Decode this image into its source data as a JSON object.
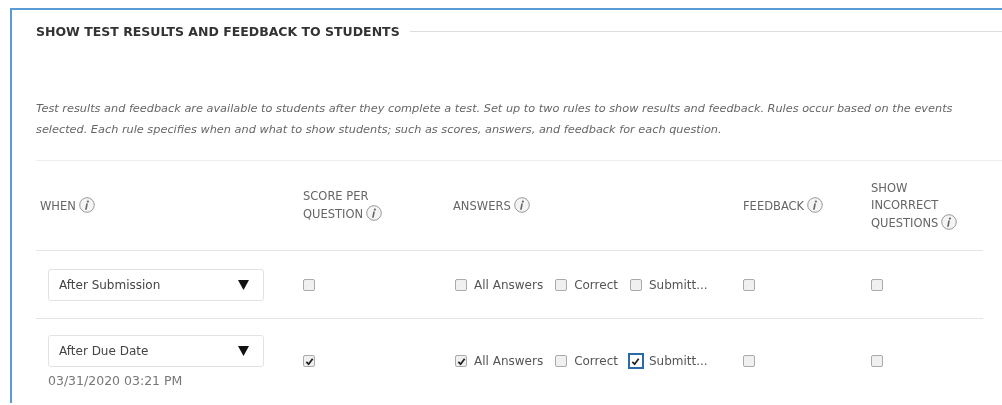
{
  "section": {
    "title": "SHOW TEST RESULTS AND FEEDBACK TO STUDENTS",
    "description": "Test results and feedback are available to students after they complete a test. Set up to two rules to show results and feedback. Rules occur based on the events selected. Each rule specifies when and what to show students; such as scores, answers, and feedback for each question."
  },
  "table": {
    "columns": [
      {
        "label": "WHEN"
      },
      {
        "label": "SCORE PER QUESTION"
      },
      {
        "label": "ANSWERS"
      },
      {
        "label": "FEEDBACK"
      },
      {
        "label": "SHOW INCORRECT QUESTIONS"
      }
    ],
    "rows": [
      {
        "when": "After Submission",
        "score_per_question": {
          "checked": false
        },
        "answers": [
          {
            "label": "All Answers",
            "checked": false,
            "focused": false
          },
          {
            "label": "Correct",
            "checked": false,
            "focused": false
          },
          {
            "label": "Submitt...",
            "checked": false,
            "focused": false
          }
        ],
        "feedback": {
          "checked": false
        },
        "show_incorrect_questions": {
          "checked": false
        }
      },
      {
        "when": "After Due Date",
        "date": "03/31/2020 03:21 PM",
        "score_per_question": {
          "checked": true
        },
        "answers": [
          {
            "label": "All Answers",
            "checked": true,
            "focused": false
          },
          {
            "label": "Correct",
            "checked": false,
            "focused": false
          },
          {
            "label": "Submitt...",
            "checked": true,
            "focused": true
          }
        ],
        "feedback": {
          "checked": false
        },
        "show_incorrect_questions": {
          "checked": false
        }
      }
    ]
  }
}
